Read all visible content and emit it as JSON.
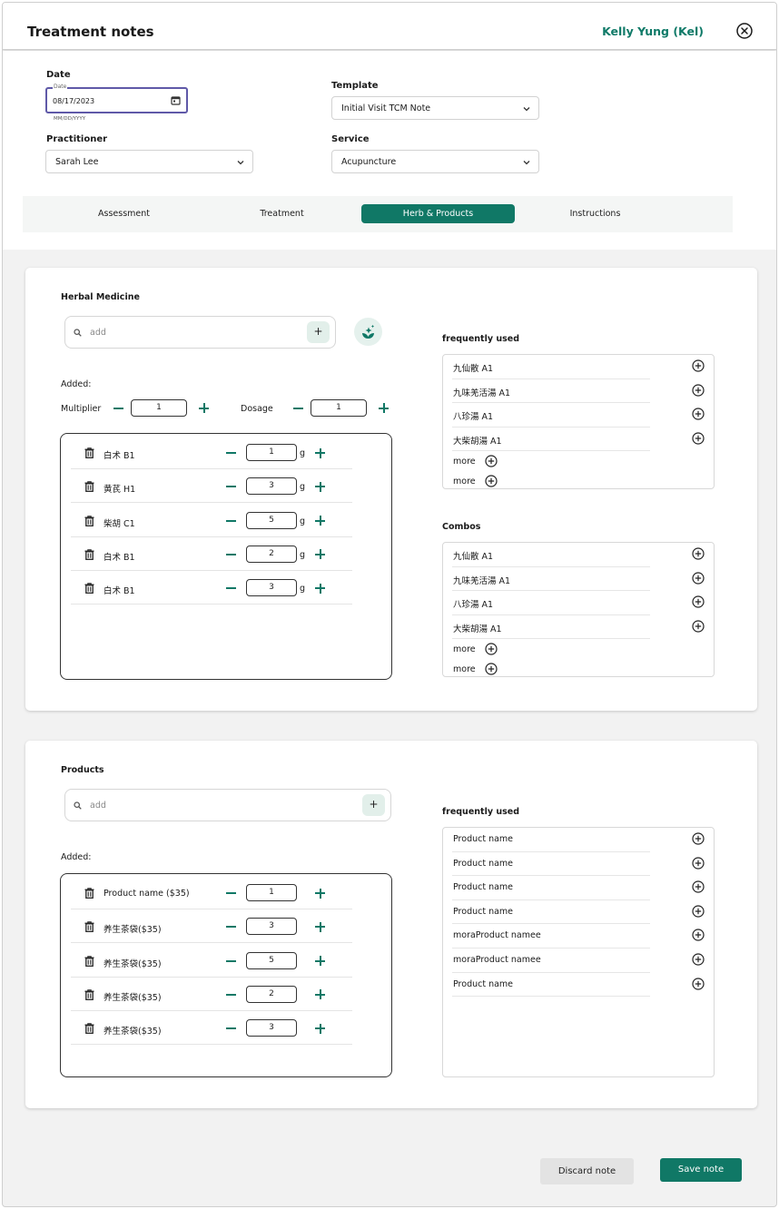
{
  "header": {
    "title": "Treatment notes",
    "patient_name": "Kelly Yung (Kel)",
    "close_icon": "close-circle-icon"
  },
  "form": {
    "date_label": "Date",
    "date_mini_label": "Date",
    "date_value": "08/17/2023",
    "date_hint": "MM/DD/YYYY",
    "template_label": "Template",
    "template_value": "Initial Visit TCM Note",
    "practitioner_label": "Practitioner",
    "practitioner_value": "Sarah Lee",
    "service_label": "Service",
    "service_value": "Acupuncture"
  },
  "tabs": [
    "Assessment",
    "Treatment",
    "Herb & Products",
    "Instructions"
  ],
  "active_tab": "Herb & Products",
  "herbal": {
    "title": "Herbal Medicine",
    "search_placeholder": "add",
    "add_button": "+",
    "added_label": "Added:",
    "multiplier_label": "Multiplier",
    "multiplier_value": "1",
    "dosage_label": "Dosage",
    "dosage_value": "1",
    "unit": "g",
    "items": [
      {
        "name": "白术 B1",
        "qty": "1"
      },
      {
        "name": "黄芪 H1",
        "qty": "3"
      },
      {
        "name": "柴胡 C1",
        "qty": "5"
      },
      {
        "name": "白术 B1",
        "qty": "2"
      },
      {
        "name": "白术 B1",
        "qty": "3"
      }
    ],
    "frequent_title": "frequently used",
    "frequent": [
      "九仙散 A1",
      "九味羌活湯 A1",
      "八珍湯 A1",
      "大柴胡湯 A1"
    ],
    "frequent_more": [
      "more",
      "more"
    ],
    "combos_title": "Combos",
    "combos": [
      "九仙散 A1",
      "九味羌活湯 A1",
      "八珍湯 A1",
      "大柴胡湯 A1"
    ],
    "combos_more": [
      "more",
      "more"
    ]
  },
  "products": {
    "title": "Products",
    "search_placeholder": "add",
    "add_button": "+",
    "added_label": "Added:",
    "items": [
      {
        "name": "Product name ($35)",
        "qty": "1"
      },
      {
        "name": "养生茶袋($35)",
        "qty": "3"
      },
      {
        "name": "养生茶袋($35)",
        "qty": "5"
      },
      {
        "name": "养生茶袋($35)",
        "qty": "2"
      },
      {
        "name": "养生茶袋($35)",
        "qty": "3"
      }
    ],
    "frequent_title": "frequently used",
    "frequent": [
      "Product name",
      "Product name",
      "Product name",
      "Product name",
      "moraProduct namee",
      "moraProduct namee",
      "Product name"
    ]
  },
  "actions": {
    "discard": "Discard note",
    "save": "Save note"
  },
  "colors": {
    "accent": "#107866",
    "patient_name": "#0f7a68",
    "date_focus_border": "#5f59a8"
  }
}
